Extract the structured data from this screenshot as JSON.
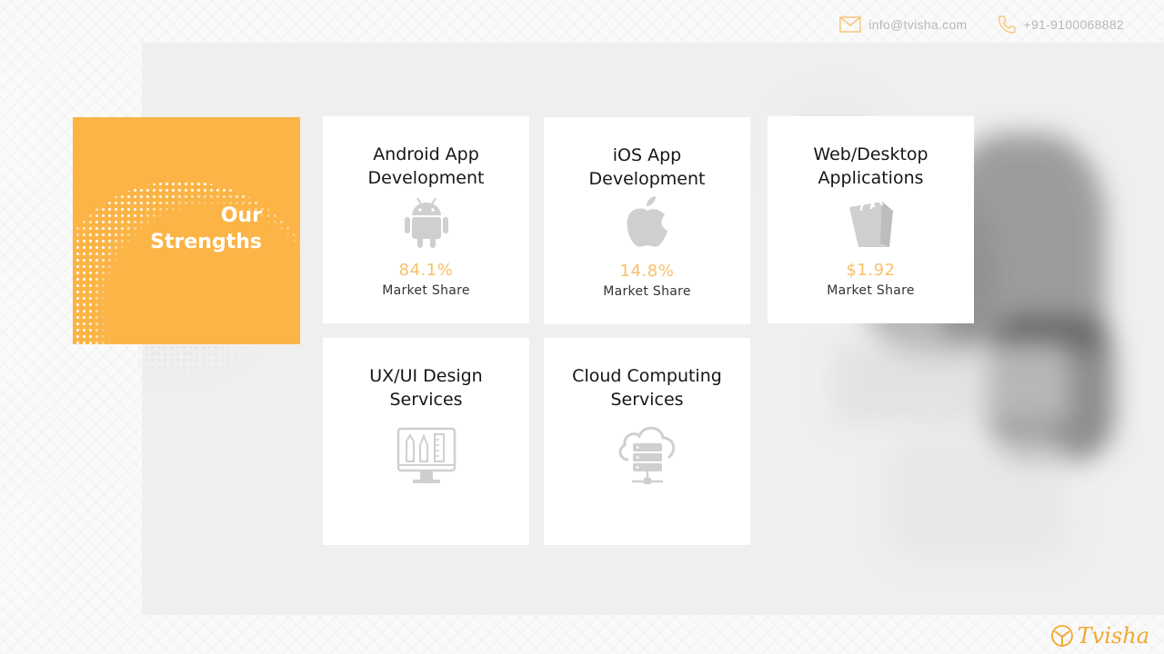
{
  "header": {
    "email": "info@tvisha.com",
    "phone": "+91-9100068882"
  },
  "panel": {
    "title_line1": "Our",
    "title_line2": "Strengths"
  },
  "cards": [
    {
      "title_line1": "Android App",
      "title_line2": "Development",
      "icon": "android-icon",
      "value": "84.1%",
      "caption": "Market Share"
    },
    {
      "title_line1": "iOS App",
      "title_line2": "Development",
      "icon": "apple-icon",
      "value": "14.8%",
      "caption": "Market Share"
    },
    {
      "title_line1": "Web/Desktop",
      "title_line2": "Applications",
      "icon": "shopping-bag-icon",
      "value": "$1.92",
      "caption": "Market Share"
    },
    {
      "title_line1": "UX/UI Design",
      "title_line2": "Services",
      "icon": "design-monitor-icon"
    },
    {
      "title_line1": "Cloud Computing",
      "title_line2": "Services",
      "icon": "cloud-server-icon"
    }
  ],
  "logo": {
    "text": "Tvisha"
  },
  "colors": {
    "accent": "#fbb445",
    "value_text": "#f9c068",
    "icon_gray": "#cfcfcf",
    "background": "#efefef"
  }
}
